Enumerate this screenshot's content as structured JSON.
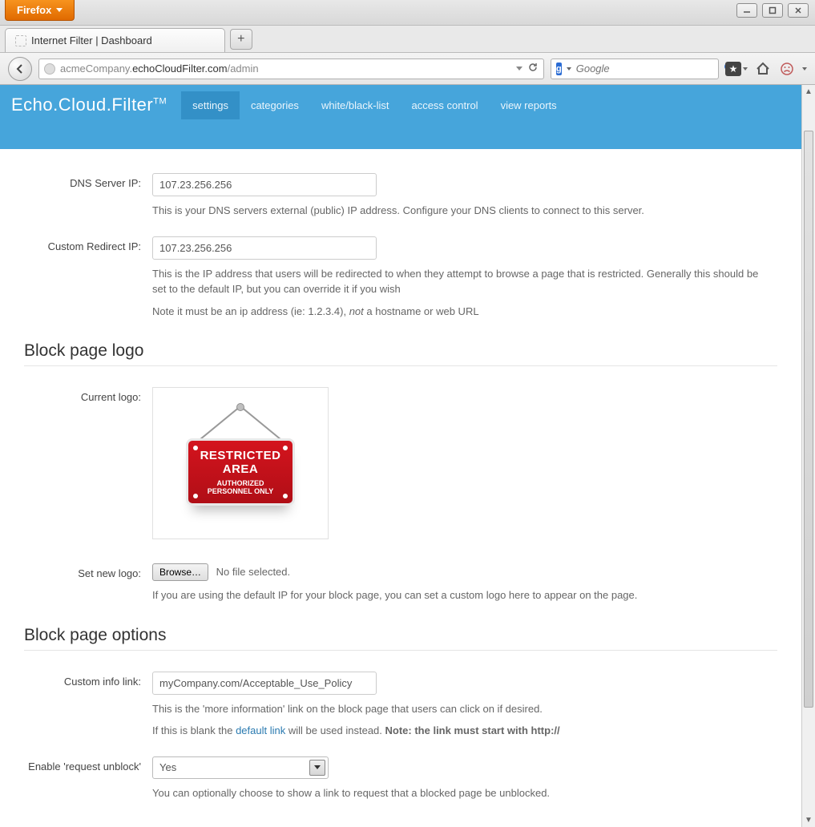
{
  "window": {
    "firefox_button": "Firefox",
    "tab_title": "Internet Filter | Dashboard",
    "url_pre": "acmeCompany.",
    "url_host": "echoCloudFilter.com",
    "url_path": "/admin",
    "search_placeholder": "Google"
  },
  "header": {
    "brand": "Echo.Cloud.Filter",
    "brand_tm": "TM",
    "nav": [
      "settings",
      "categories",
      "white/black-list",
      "access control",
      "view reports"
    ],
    "active_index": 0
  },
  "settings": {
    "dns_label": "DNS Server IP:",
    "dns_value": "107.23.256.256",
    "dns_help": "This is your DNS servers external (public) IP address. Configure your DNS clients to connect to this server.",
    "redirect_label": "Custom Redirect IP:",
    "redirect_value": "107.23.256.256",
    "redirect_help1": "This is the IP address that users will be redirected to when they attempt to browse a page that is restricted. Generally this should be set to the default IP, but you can override it if you wish",
    "redirect_help2_pre": "Note it must be an ip address (ie: 1.2.3.4), ",
    "redirect_help2_em": "not",
    "redirect_help2_post": " a hostname or web URL"
  },
  "block_logo": {
    "section_title": "Block page logo",
    "current_label": "Current logo:",
    "sign": {
      "l1": "RESTRICTED",
      "l2": "AREA",
      "l3": "AUTHORIZED",
      "l4": "PERSONNEL ONLY"
    },
    "set_label": "Set new logo:",
    "browse_label": "Browse…",
    "file_status": "No file selected.",
    "set_help": "If you are using the default IP for your block page, you can set a custom logo here to appear on the page."
  },
  "block_options": {
    "section_title": "Block page options",
    "info_label": "Custom info link:",
    "info_value": "myCompany.com/Acceptable_Use_Policy",
    "info_help1": "This is the 'more information' link on the block page that users can click on if desired.",
    "info_help2_pre": "If this is blank the ",
    "info_help2_link": "default link",
    "info_help2_mid": " will be used instead.  ",
    "info_help2_bold": "Note: the link must start with http://",
    "unblock_label": "Enable 'request unblock'",
    "unblock_value": "Yes",
    "unblock_help": "You can optionally choose to show a link to request that a blocked page be unblocked."
  }
}
